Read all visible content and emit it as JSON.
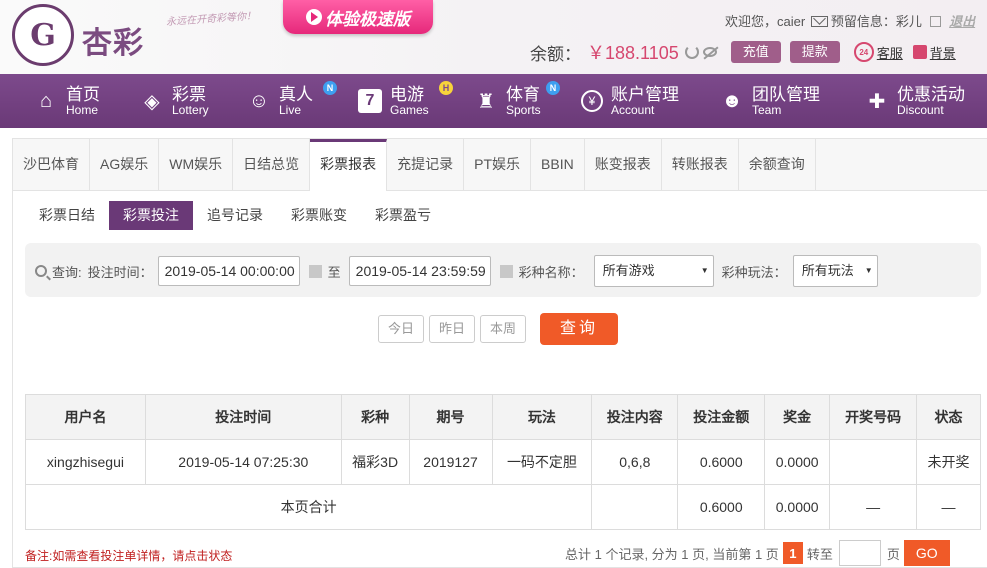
{
  "brand": {
    "logo_mark": "G",
    "logo_text": "杏彩",
    "slogan": "永远在开奇彩等你！",
    "fast_version": "体验极速版"
  },
  "user": {
    "welcome": "欢迎您，",
    "username": "caier",
    "notice_label": "预留信息：",
    "notice_value": "彩儿",
    "logout": "退出"
  },
  "account": {
    "balance_label": "余额：",
    "balance_value": "￥188.1105",
    "recharge": "充值",
    "withdraw": "提款",
    "service_badge": "24",
    "service": "客服",
    "background": "背景"
  },
  "nav": [
    {
      "cn": "首页",
      "en": "Home",
      "icon": "home-icon",
      "badge": ""
    },
    {
      "cn": "彩票",
      "en": "Lottery",
      "icon": "ticket-icon",
      "badge": ""
    },
    {
      "cn": "真人",
      "en": "Live",
      "icon": "person-icon",
      "badge": "N"
    },
    {
      "cn": "电游",
      "en": "Games",
      "icon": "seven-icon",
      "badge": "H"
    },
    {
      "cn": "体育",
      "en": "Sports",
      "icon": "trophy-icon",
      "badge": "N"
    },
    {
      "cn": "账户管理",
      "en": "Account",
      "icon": "coin-icon",
      "badge": ""
    },
    {
      "cn": "团队管理",
      "en": "Team",
      "icon": "team-icon",
      "badge": ""
    },
    {
      "cn": "优惠活动",
      "en": "Discount",
      "icon": "gift-icon",
      "badge": ""
    }
  ],
  "tabs": [
    "沙巴体育",
    "AG娱乐",
    "WM娱乐",
    "日结总览",
    "彩票报表",
    "充提记录",
    "PT娱乐",
    "BBIN",
    "账变报表",
    "转账报表",
    "余额查询"
  ],
  "active_tab": "彩票报表",
  "subtabs": [
    "彩票日结",
    "彩票投注",
    "追号记录",
    "彩票账变",
    "彩票盈亏"
  ],
  "active_subtab": "彩票投注",
  "filter": {
    "query_label": "查询:",
    "time_label": "投注时间：",
    "start": "2019-05-14 00:00:00",
    "to": "至",
    "end": "2019-05-14 23:59:59",
    "game_label": "彩种名称：",
    "game_value": "所有游戏",
    "play_label": "彩种玩法：",
    "play_value": "所有玩法"
  },
  "quick": {
    "today": "今日",
    "yesterday": "昨日",
    "week": "本周",
    "query": "查询"
  },
  "table": {
    "headers": [
      "用户名",
      "投注时间",
      "彩种",
      "期号",
      "玩法",
      "投注内容",
      "投注金额",
      "奖金",
      "开奖号码",
      "状态"
    ],
    "rows": [
      [
        "xingzhisegui",
        "2019-05-14 07:25:30",
        "福彩3D",
        "2019127",
        "一码不定胆",
        "0,6,8",
        "0.6000",
        "0.0000",
        "",
        "未开奖"
      ]
    ],
    "total": {
      "label": "本页合计",
      "amount": "0.6000",
      "bonus": "0.0000",
      "draw": "—",
      "status": "—"
    }
  },
  "footer": {
    "note": "备注:如需查看投注单详情，请点击状态",
    "summary": "总计 1 个记录, 分为 1 页, 当前第 1 页",
    "current_page": "1",
    "goto": "转至",
    "page_unit": "页",
    "go": "GO"
  }
}
